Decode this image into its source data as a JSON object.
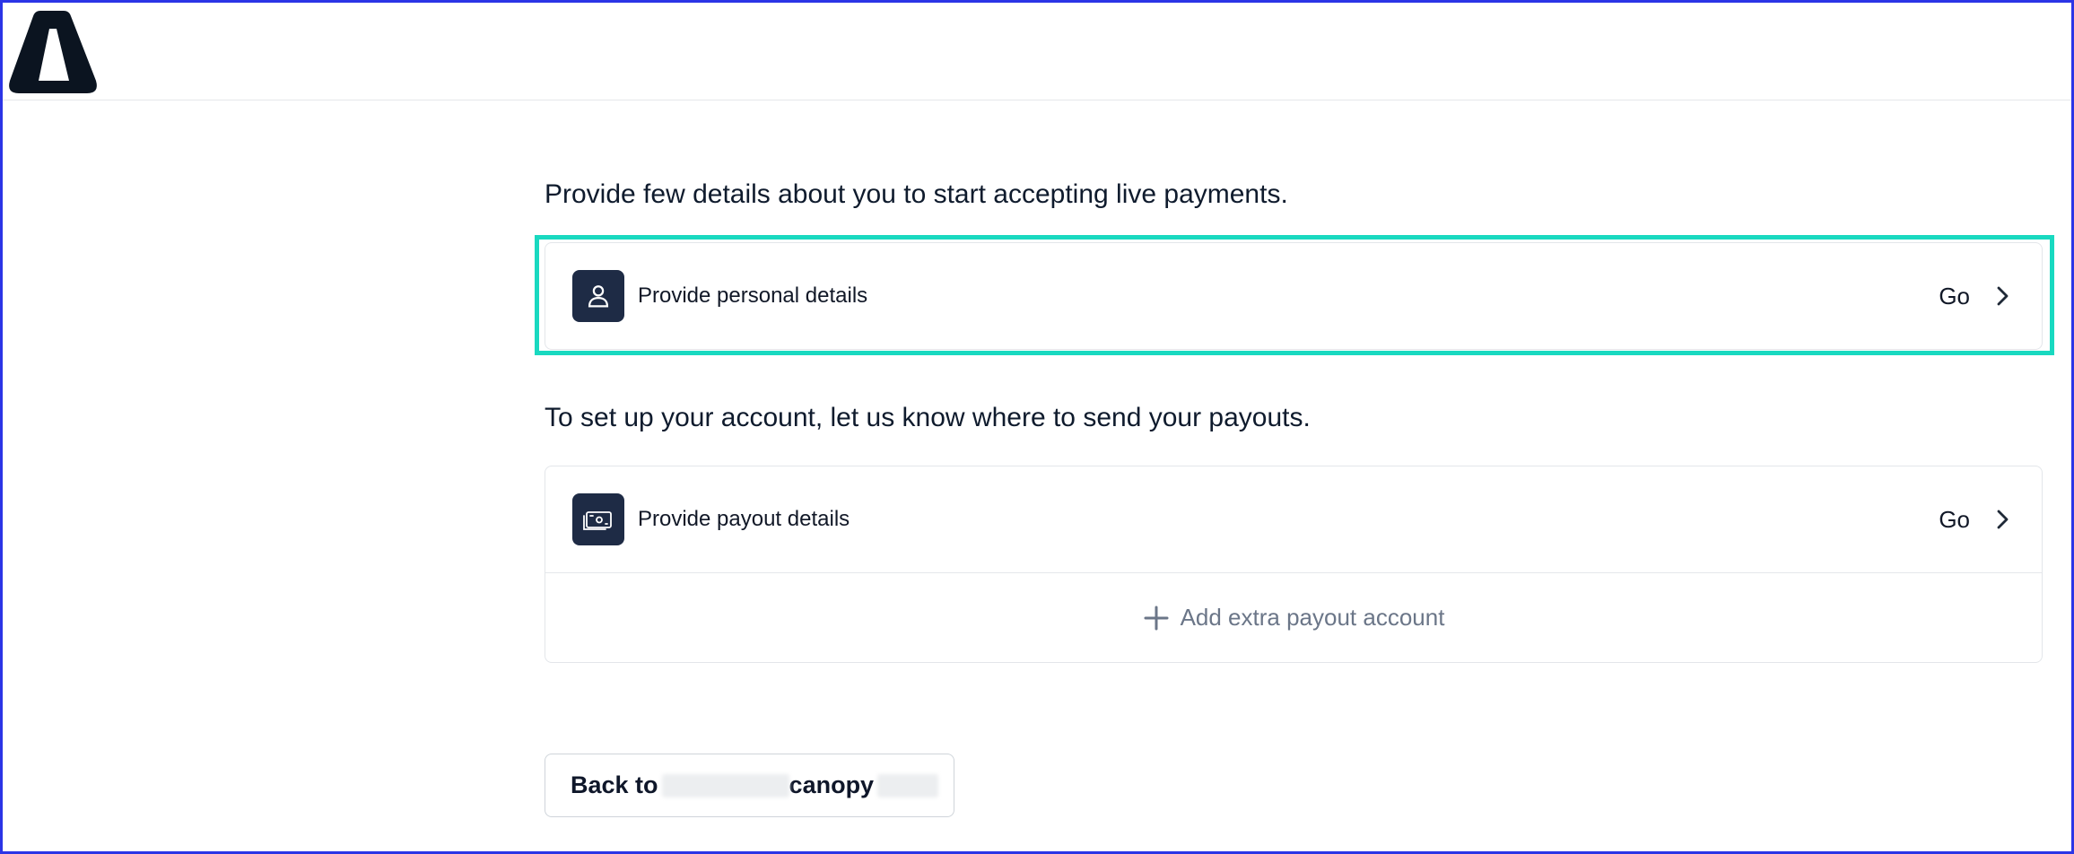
{
  "header": {
    "logo_icon": "brand-triangle-logo"
  },
  "sections": {
    "personal": {
      "heading": "Provide few details about you to start accepting live payments.",
      "row_label": "Provide personal details",
      "row_icon": "user-icon",
      "go_label": "Go"
    },
    "payout": {
      "heading": "To set up your account, let us know where to send your payouts.",
      "row_label": "Provide payout details",
      "row_icon": "banknote-icon",
      "go_label": "Go",
      "add_label": "Add extra payout account"
    }
  },
  "footer": {
    "back_prefix": "Back to",
    "back_name": "canopy"
  },
  "colors": {
    "icon_tile": "#1e2b45",
    "highlight": "#19d9c0",
    "frame": "#2b35e6"
  }
}
